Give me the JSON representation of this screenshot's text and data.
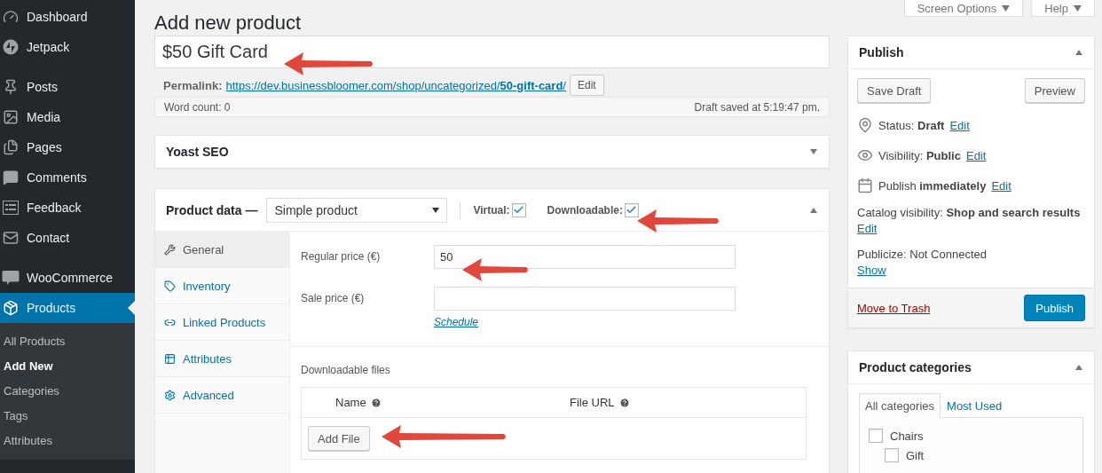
{
  "sidebar": {
    "groups": [
      {
        "items": [
          {
            "label": "Dashboard",
            "selected": false
          },
          {
            "label": "Jetpack",
            "selected": false
          }
        ]
      },
      {
        "items": [
          {
            "label": "Posts",
            "selected": false
          },
          {
            "label": "Media",
            "selected": false
          },
          {
            "label": "Pages",
            "selected": false
          },
          {
            "label": "Comments",
            "selected": false
          },
          {
            "label": "Feedback",
            "selected": false
          },
          {
            "label": "Contact",
            "selected": false
          }
        ]
      },
      {
        "items": [
          {
            "label": "WooCommerce",
            "selected": false
          },
          {
            "label": "Products",
            "selected": true,
            "submenu": [
              {
                "label": "All Products",
                "selected": false
              },
              {
                "label": "Add New",
                "selected": true
              },
              {
                "label": "Categories",
                "selected": false
              },
              {
                "label": "Tags",
                "selected": false
              },
              {
                "label": "Attributes",
                "selected": false
              }
            ]
          }
        ]
      }
    ]
  },
  "screen_tabs": [
    "Screen Options",
    "Help"
  ],
  "page_title": "Add new product",
  "product_title": {
    "value": "$50 Gift Card"
  },
  "permalink": {
    "label": "Permalink:",
    "url": "https://dev.businessbloomer.com/shop/uncategorized/",
    "slug": "50-gift-card",
    "trailing": "/",
    "edit_button": "Edit"
  },
  "status_bar": {
    "word_count": "Word count: 0",
    "draft_saved": "Draft saved at 5:19:47 pm."
  },
  "yoast": {
    "title": "Yoast SEO",
    "expanded": false
  },
  "product_data": {
    "title": "Product data —",
    "type": "Simple product",
    "virtual": {
      "label": "Virtual:",
      "checked": true
    },
    "downloadable": {
      "label": "Downloadable:",
      "checked": true
    },
    "expanded": true,
    "tabs": [
      {
        "label": "General",
        "selected": true
      },
      {
        "label": "Inventory",
        "selected": false
      },
      {
        "label": "Linked Products",
        "selected": false
      },
      {
        "label": "Attributes",
        "selected": false
      },
      {
        "label": "Advanced",
        "selected": false
      }
    ],
    "fields": [
      {
        "label": "Regular price (€)",
        "value": "50"
      },
      {
        "label": "Sale price (€)"
      }
    ],
    "schedule_link": "Schedule",
    "downloadable_files": {
      "title": "Downloadable files",
      "columns": [
        "Name",
        "File URL"
      ],
      "add_button": "Add File"
    }
  },
  "publish": {
    "title": "Publish",
    "expanded": true,
    "save_draft": "Save Draft",
    "preview": "Preview",
    "rows": [
      {
        "kind": "inline",
        "text": "Status: **Draft**",
        "link": "Edit"
      },
      {
        "kind": "inline",
        "text": "Visibility: **Public**",
        "link": "Edit"
      },
      {
        "kind": "inline",
        "text": "Publish **immediately**",
        "link": "Edit"
      },
      {
        "kind": "block",
        "text": "Catalog visibility: **Shop and search results**",
        "link": "Edit"
      },
      {
        "kind": "block",
        "text": "Publicize: Not Connected",
        "link": "Show"
      }
    ],
    "trash_link": "Move to Trash",
    "publish_button": "Publish"
  },
  "categories": {
    "title": "Product categories",
    "expanded": true,
    "tabs": [
      {
        "label": "All categories",
        "selected": true
      },
      {
        "label": "Most Used",
        "selected": false
      }
    ],
    "items": [
      {
        "label": "Chairs",
        "checked": false,
        "children": [
          {
            "label": "Gift",
            "checked": false
          }
        ]
      }
    ]
  }
}
